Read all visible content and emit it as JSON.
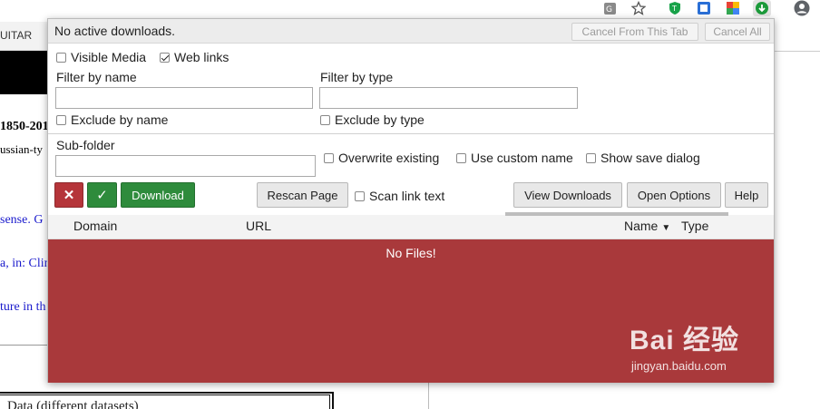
{
  "background": {
    "nav_text": "UITAR",
    "lines": [
      {
        "text": "1850-201",
        "color": "#000000",
        "bold": true
      },
      {
        "text": "ussian-ty",
        "color": "#000000",
        "bold": false
      },
      {
        "text": "sense. G",
        "color": "#1a1acc",
        "bold": false
      },
      {
        "text": "a, in: Clin",
        "color": "#1a1acc",
        "bold": false
      },
      {
        "text": "ture in th",
        "color": "#1a1acc",
        "bold": false
      }
    ],
    "box_text": "Data (different datasets)"
  },
  "extensions": [
    "translate-icon",
    "star-icon",
    "shield-icon",
    "extension-icon",
    "colorful-icon",
    "download-icon",
    "profile-icon"
  ],
  "popup": {
    "status": "No active downloads.",
    "cancel_tab_label": "Cancel From This Tab",
    "cancel_all_label": "Cancel All",
    "visible_media_label": "Visible Media",
    "visible_media_checked": false,
    "web_links_label": "Web links",
    "web_links_checked": true,
    "filter_name_label": "Filter by name",
    "filter_name_value": "",
    "filter_type_label": "Filter by type",
    "filter_type_value": "",
    "exclude_name_label": "Exclude by name",
    "exclude_type_label": "Exclude by type",
    "subfolder_label": "Sub-folder",
    "subfolder_value": "",
    "overwrite_label": "Overwrite existing",
    "custom_name_label": "Use custom name",
    "save_dialog_label": "Show save dialog",
    "cancel_glyph": "✕",
    "confirm_glyph": "✓",
    "download_label": "Download",
    "rescan_label": "Rescan Page",
    "scan_link_label": "Scan link text",
    "view_downloads_label": "View Downloads",
    "open_options_label": "Open Options",
    "help_label": "Help",
    "columns": {
      "domain": "Domain",
      "url": "URL",
      "name": "Name",
      "type": "Type"
    },
    "sort_arrow": "▼",
    "empty_message": "No Files!",
    "accent_red": "#a9393b",
    "accent_green": "#2e8b3c"
  },
  "watermark": {
    "logo": "Bai 经验",
    "sub": "jingyan.baidu.com"
  }
}
